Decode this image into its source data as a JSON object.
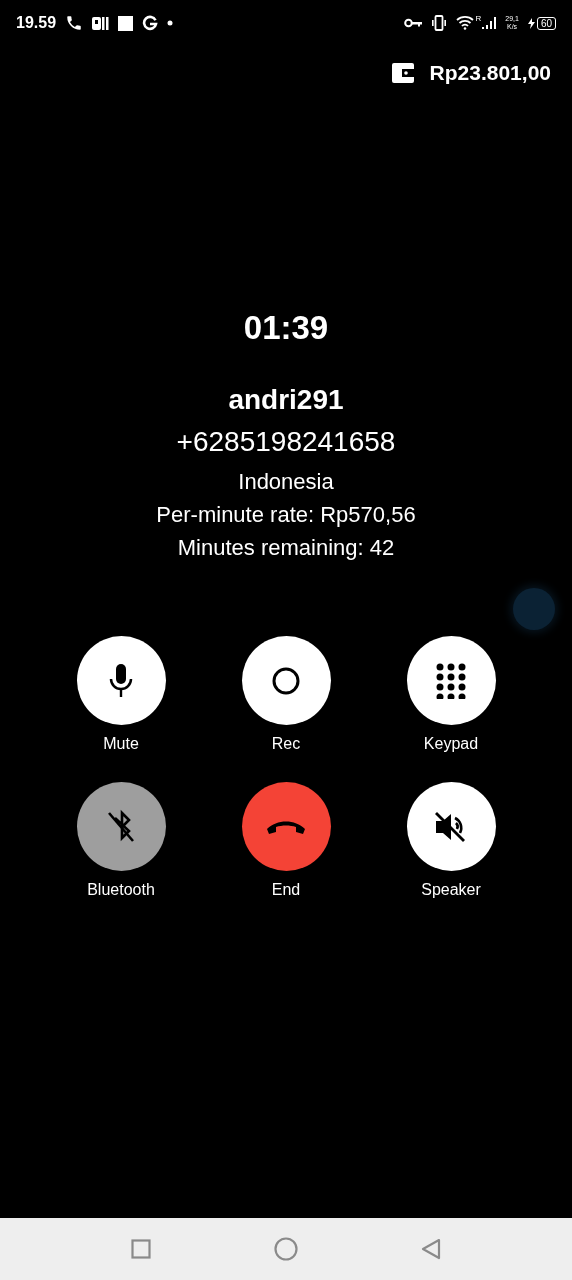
{
  "status_bar": {
    "time": "19.59",
    "network_type": "R",
    "speed_value": "29,1",
    "speed_unit": "K/s",
    "battery": "60"
  },
  "balance": "Rp23.801,00",
  "call": {
    "timer": "01:39",
    "name": "andri291",
    "number": "+6285198241658",
    "country": "Indonesia",
    "rate": "Per-minute rate: Rp570,56",
    "remaining": "Minutes remaining: 42"
  },
  "controls": [
    {
      "kind": "mic",
      "label": "Mute",
      "disabled": false
    },
    {
      "kind": "record",
      "label": "Rec",
      "disabled": false
    },
    {
      "kind": "keypad",
      "label": "Keypad",
      "disabled": false
    },
    {
      "kind": "bluetooth-off",
      "label": "Bluetooth",
      "disabled": true
    },
    {
      "kind": "end",
      "label": "End",
      "disabled": false
    },
    {
      "kind": "speaker-off",
      "label": "Speaker",
      "disabled": false
    }
  ]
}
